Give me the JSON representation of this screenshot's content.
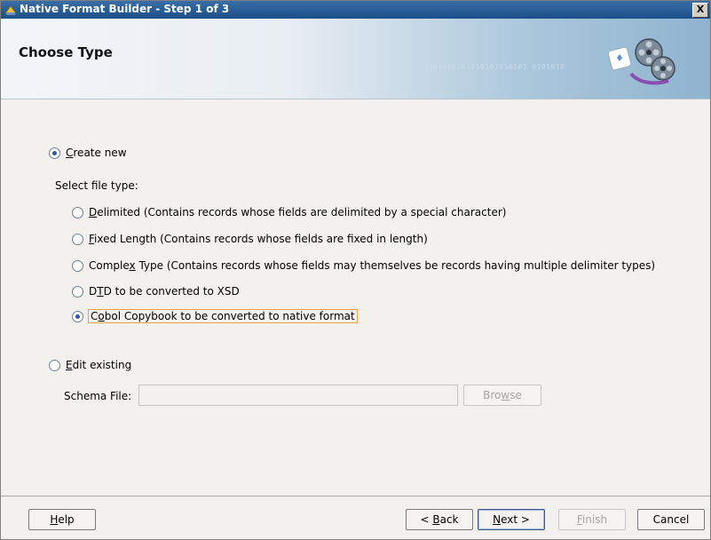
{
  "window": {
    "title": "Native Format Builder - Step 1 of 3",
    "close_label": "X"
  },
  "header": {
    "heading": "Choose Type",
    "decor_binary": "0101010101010101010101 0101010"
  },
  "create_new": {
    "prefix": "",
    "mnemonic": "C",
    "rest": "reate new",
    "checked": true
  },
  "select_file_type_label": "Select file type:",
  "file_types": [
    {
      "mnemonic": "D",
      "rest": "elimited (Contains records whose fields are delimited by a special character)",
      "pre": "",
      "checked": false
    },
    {
      "mnemonic": "F",
      "rest": "ixed Length (Contains records whose fields are fixed in length)",
      "pre": "",
      "checked": false
    },
    {
      "pre": "Comple",
      "mnemonic": "x",
      "rest": " Type (Contains records whose fields may themselves be records having multiple delimiter types)",
      "checked": false
    },
    {
      "pre": "D",
      "mnemonic": "T",
      "rest": "D to be converted to XSD",
      "checked": false
    },
    {
      "pre": "C",
      "mnemonic": "o",
      "rest": "bol Copybook to be converted to native format",
      "checked": true
    }
  ],
  "edit_existing": {
    "prefix": "",
    "mnemonic": "E",
    "rest": "dit existing",
    "checked": false
  },
  "schema_file": {
    "label": "Schema File:",
    "value": "",
    "browse_pre": "Bro",
    "browse_mnemonic": "w",
    "browse_rest": "se"
  },
  "buttons": {
    "help_mnemonic": "H",
    "help_rest": "elp",
    "back_pre": "< ",
    "back_mnemonic": "B",
    "back_rest": "ack",
    "next_mnemonic": "N",
    "next_rest": "ext >",
    "finish_mnemonic": "F",
    "finish_rest": "inish",
    "cancel": "Cancel"
  }
}
